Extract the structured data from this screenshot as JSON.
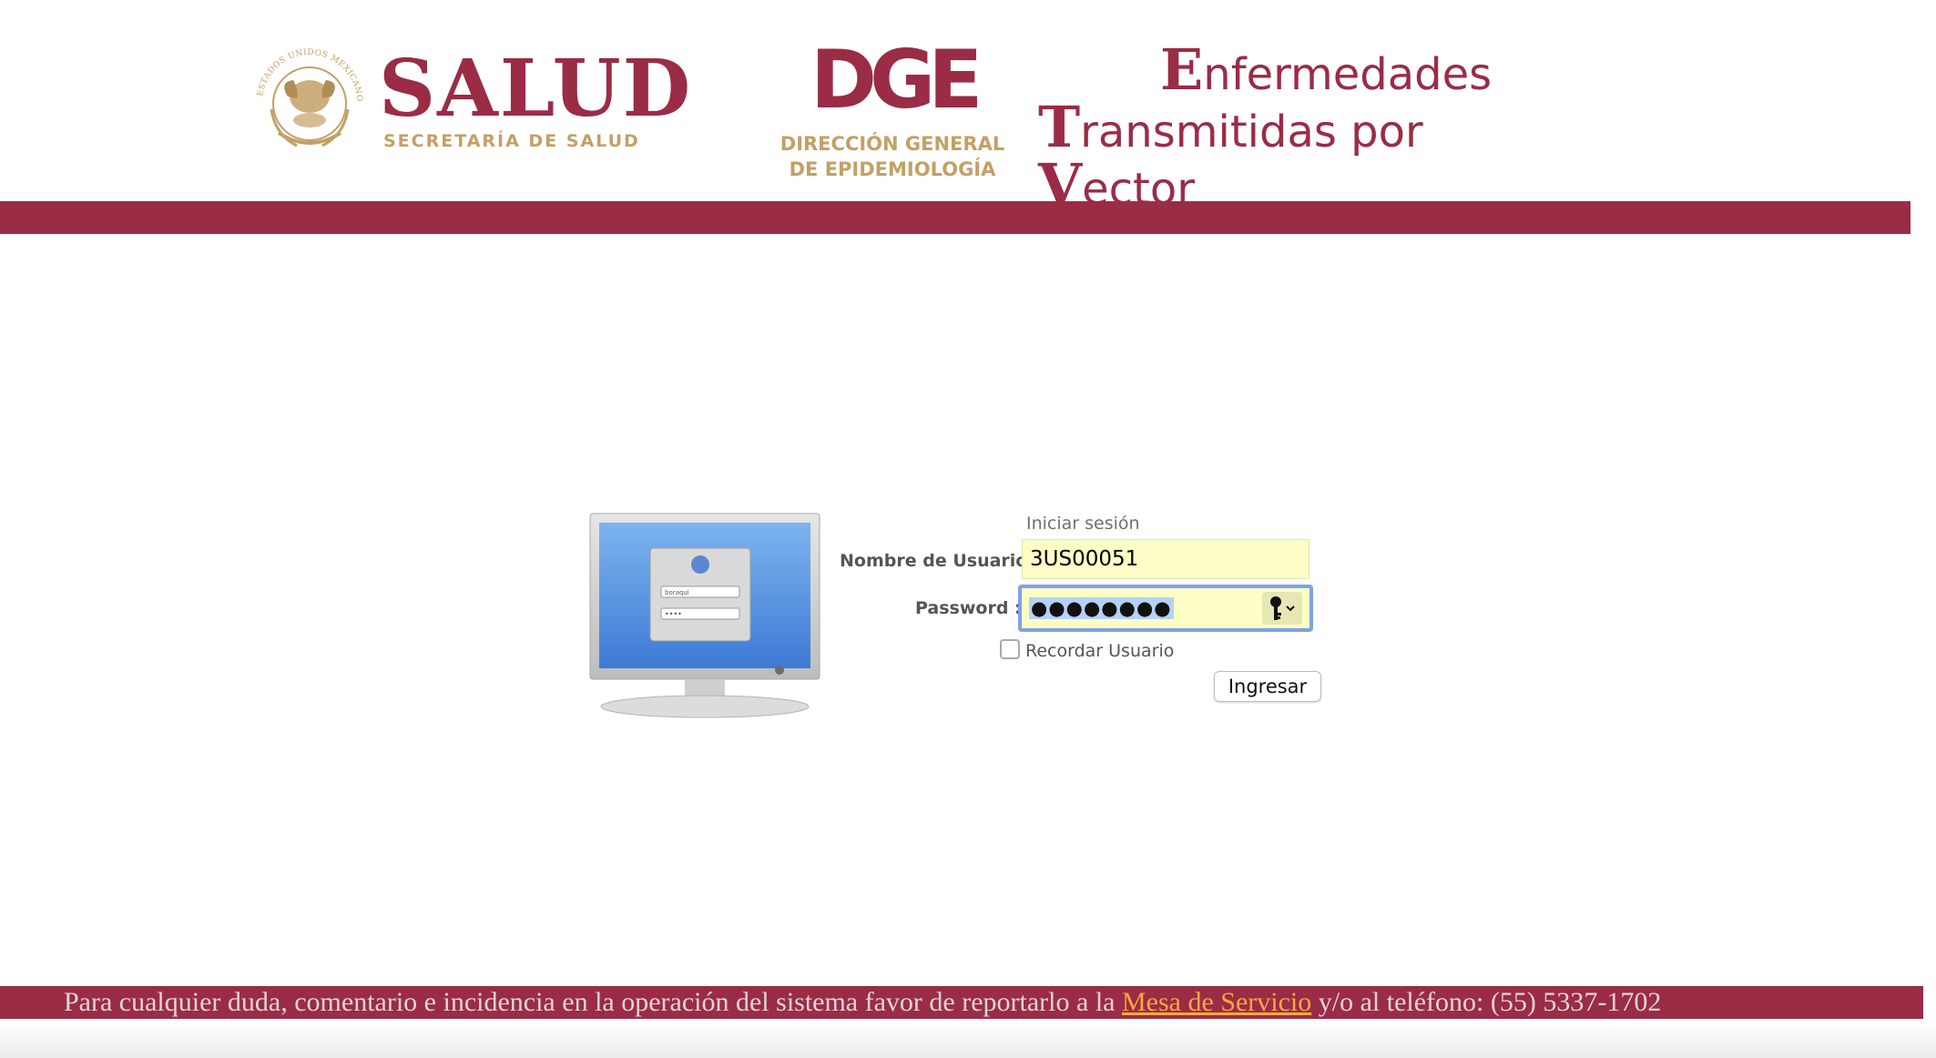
{
  "header": {
    "salud_title": "SALUD",
    "salud_subtitle": "SECRETARÍA DE SALUD",
    "emblem_ring_text": "ESTADOS UNIDOS MEXICANOS",
    "dge_logo_text": "DGE",
    "dge_line1": "DIRECCIÓN GENERAL",
    "dge_line2": "DE EPIDEMIOLOGÍA",
    "system_title": {
      "line1_cap": "E",
      "line1_rest": "nfermedades",
      "line2_cap1": "T",
      "line2_mid": "ransmitidas por ",
      "line2_cap2": "V",
      "line2_rest": "ector"
    }
  },
  "login": {
    "title": "Iniciar sesión",
    "username_label": "Nombre de Usuario",
    "username_value": "3US00051",
    "password_label": "Password :",
    "password_mask": "●●●●●●●●",
    "remember_label": "Recordar Usuario",
    "submit_label": "Ingresar",
    "monitor_illustration": {
      "field_user": "boraqui",
      "field_pass": "••••"
    }
  },
  "footer": {
    "text_before": "Para cualquier duda, comentario e incidencia en la operación del sistema favor de reportarlo a la ",
    "link_text": "Mesa de Servicio",
    "text_after": " y/o al teléfono: (55) 5337-1702"
  },
  "colors": {
    "brand": "#9a2c46",
    "gold": "#c3a066",
    "field_bg": "#fdfdc6",
    "focus": "#7ea2e4",
    "link": "#f4a93c"
  },
  "icons": {
    "emblem": "mexico-coat-of-arms-icon",
    "monitor": "login-monitor-icon",
    "key": "key-icon",
    "dropdown": "chevron-down-icon"
  }
}
